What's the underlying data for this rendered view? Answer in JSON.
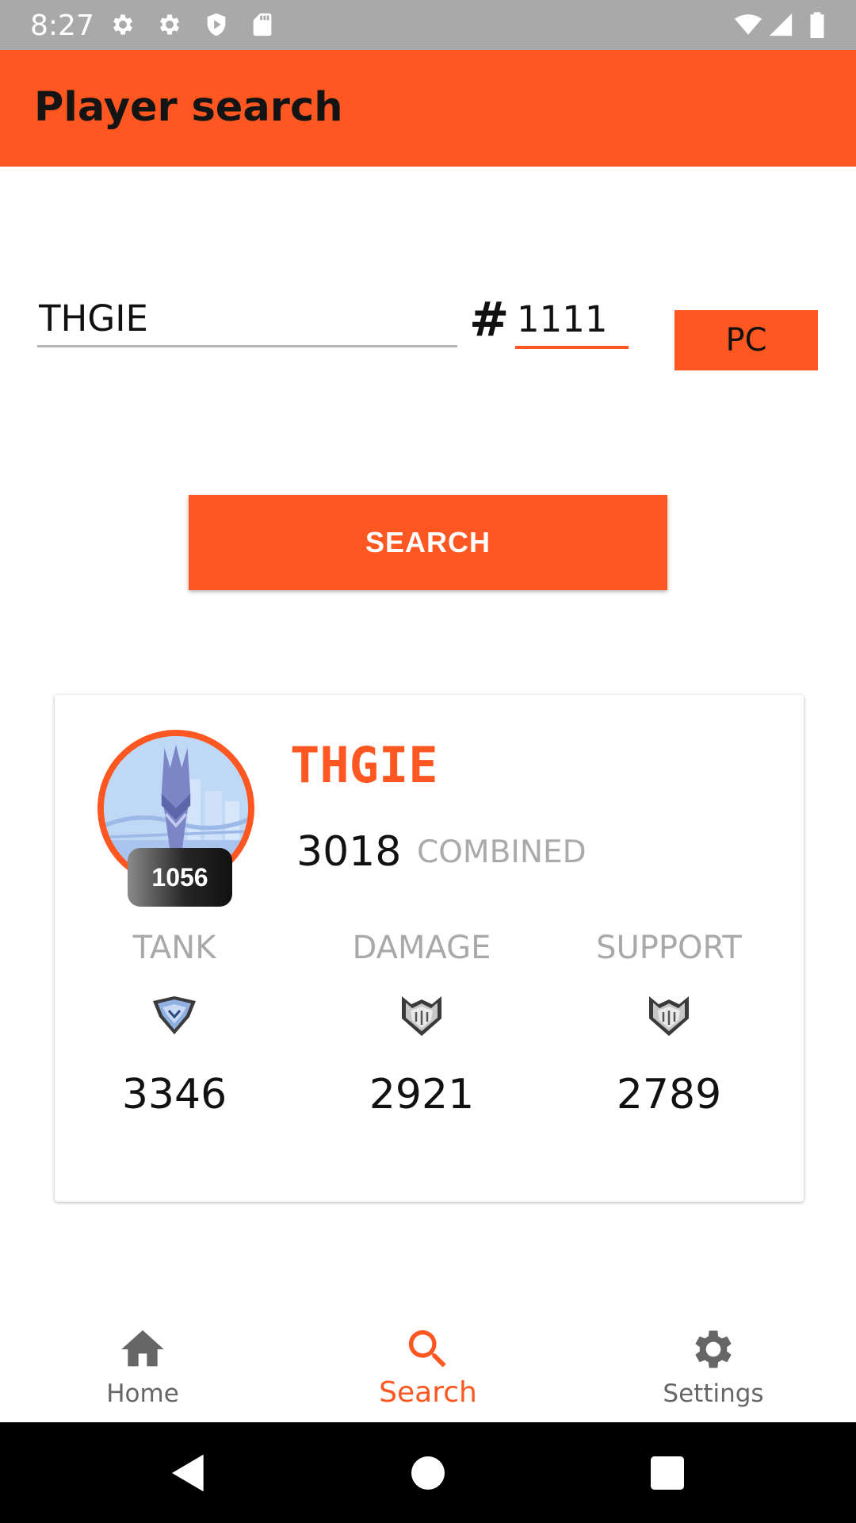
{
  "status_bar": {
    "time": "8:27",
    "icons": [
      "settings-icon",
      "settings-icon",
      "shield-icon",
      "sd-card-icon",
      "wifi-icon",
      "signal-icon",
      "battery-icon"
    ]
  },
  "app_bar": {
    "title": "Player search"
  },
  "search_form": {
    "name_value": "THGIE",
    "hash_label": "#",
    "tag_value": "1111",
    "platform_label": "PC",
    "search_button_label": "SEARCH"
  },
  "player_card": {
    "name": "THGIE",
    "level": "1056",
    "combined_value": "3018",
    "combined_label": "COMBINED",
    "roles": [
      {
        "label": "TANK",
        "value": "3346",
        "icon": "diamond-rank-icon"
      },
      {
        "label": "DAMAGE",
        "value": "2921",
        "icon": "platinum-rank-icon"
      },
      {
        "label": "SUPPORT",
        "value": "2789",
        "icon": "platinum-rank-icon"
      }
    ]
  },
  "bottom_nav": {
    "items": [
      {
        "label": "Home",
        "icon": "home-icon"
      },
      {
        "label": "Search",
        "icon": "search-icon",
        "active": true
      },
      {
        "label": "Settings",
        "icon": "gear-icon"
      }
    ]
  },
  "system_nav": {
    "icons": [
      "back-icon",
      "home-circle-icon",
      "recents-icon"
    ]
  },
  "colors": {
    "accent": "#ff5722",
    "status_bar": "#a9a9a9",
    "muted_text": "#a9a9a9",
    "nav_inactive": "#666666",
    "system_nav": "#000000"
  }
}
